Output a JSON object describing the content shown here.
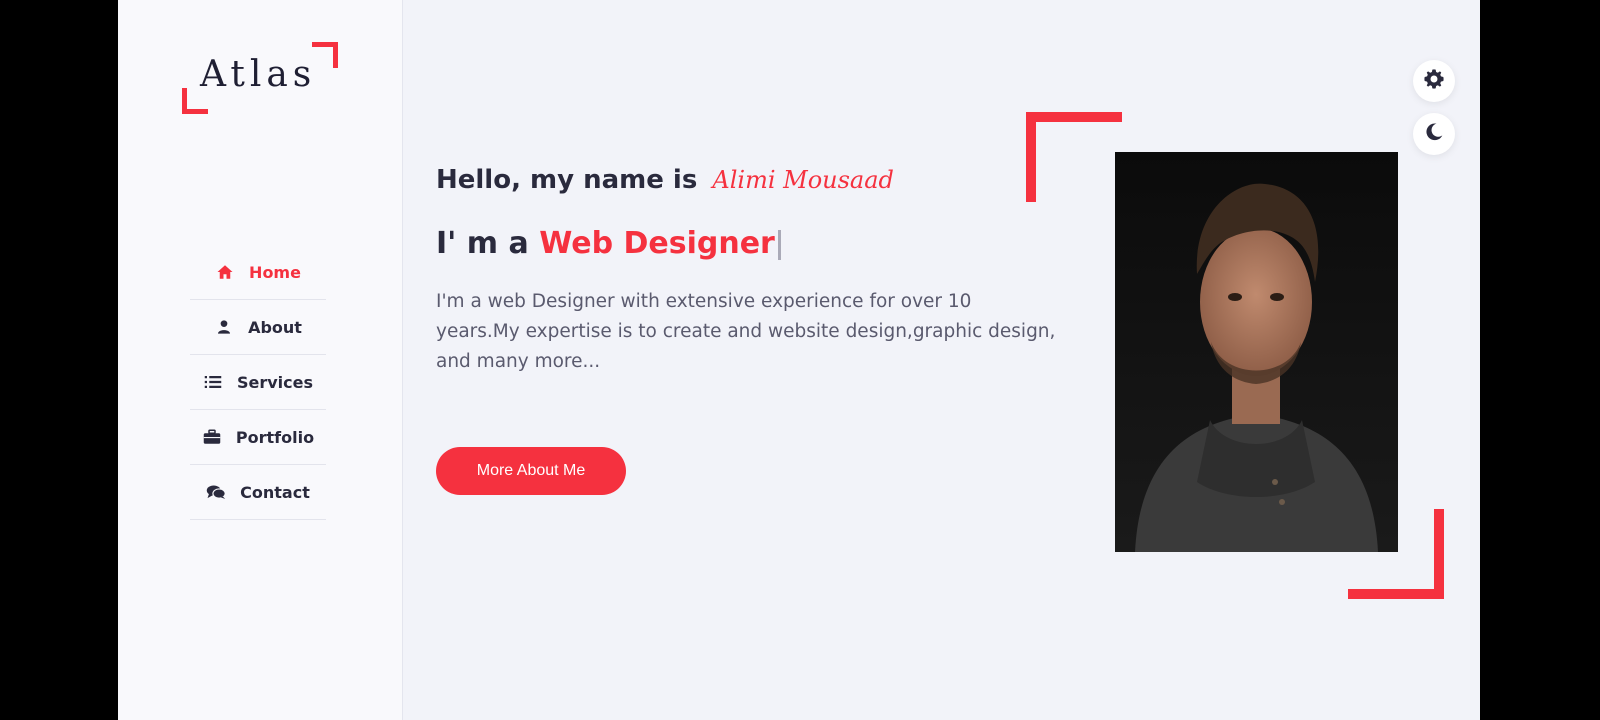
{
  "brand": {
    "logo_text": "Atlas",
    "accent": "#f5313f"
  },
  "sidebar": {
    "items": [
      {
        "label": "Home",
        "icon": "home-icon",
        "active": true
      },
      {
        "label": "About",
        "icon": "user-icon",
        "active": false
      },
      {
        "label": "Services",
        "icon": "list-icon",
        "active": false
      },
      {
        "label": "Portfolio",
        "icon": "briefcase-icon",
        "active": false
      },
      {
        "label": "Contact",
        "icon": "comments-icon",
        "active": false
      }
    ]
  },
  "hero": {
    "greeting": "Hello, my name is",
    "name": "Alimi Mousaad",
    "role_prefix": "I' m a",
    "role": "Web Designer",
    "description": "I'm a web Designer with extensive experience for over 10 years.My expertise is to create and website design,graphic design, and many more...",
    "button_label": "More About Me"
  },
  "controls": {
    "settings_icon": "gear-icon",
    "theme_icon": "moon-icon"
  }
}
